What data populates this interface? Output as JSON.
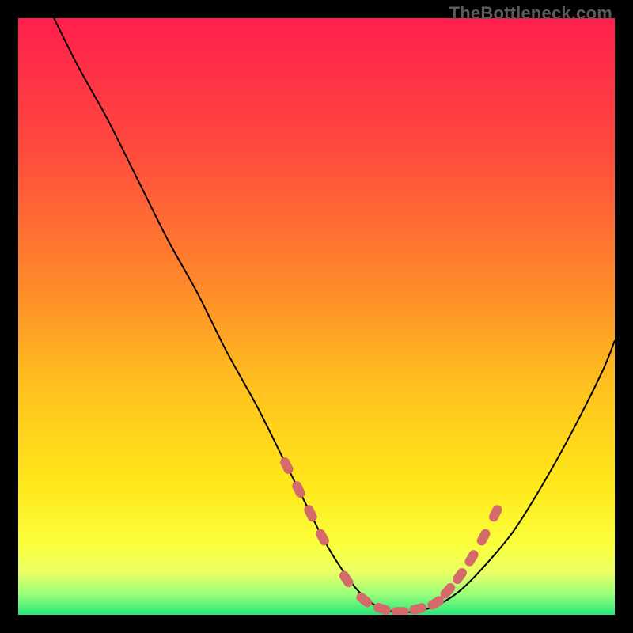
{
  "watermark": "TheBottleneck.com",
  "colors": {
    "frame": "#000000",
    "line": "#000000",
    "markers": "#d46a6a",
    "green_band_top": "#5bff8b",
    "green_band_bottom": "#28e67a"
  },
  "chart_data": {
    "type": "line",
    "title": "",
    "xlabel": "",
    "ylabel": "",
    "xlim": [
      0,
      100
    ],
    "ylim": [
      0,
      100
    ],
    "grid": false,
    "legend": false,
    "gradient_stops": [
      {
        "offset": 0.0,
        "color": "#ff1f4b"
      },
      {
        "offset": 0.22,
        "color": "#ff4a3e"
      },
      {
        "offset": 0.45,
        "color": "#ff8a2a"
      },
      {
        "offset": 0.62,
        "color": "#ffc21e"
      },
      {
        "offset": 0.78,
        "color": "#ffe71a"
      },
      {
        "offset": 0.88,
        "color": "#fbff3a"
      },
      {
        "offset": 0.93,
        "color": "#e9ff66"
      },
      {
        "offset": 0.965,
        "color": "#9bff7a"
      },
      {
        "offset": 1.0,
        "color": "#28e67a"
      }
    ],
    "series": [
      {
        "name": "bottleneck-curve",
        "x": [
          6,
          10,
          15,
          20,
          25,
          30,
          35,
          40,
          44,
          48,
          51,
          54,
          57,
          60,
          63,
          66,
          70,
          74,
          78,
          83,
          88,
          93,
          98,
          100
        ],
        "y": [
          100,
          92,
          83,
          73,
          63,
          54,
          44,
          35,
          27,
          19,
          13,
          8,
          4,
          1.5,
          0.5,
          0.5,
          1.5,
          4,
          8,
          14,
          22,
          31,
          41,
          46
        ]
      }
    ],
    "markers": {
      "name": "highlighted-points",
      "x": [
        45,
        47,
        49,
        51,
        55,
        58,
        61,
        64,
        67,
        70,
        72,
        74,
        76,
        78,
        80
      ],
      "y": [
        25,
        21,
        17,
        13,
        6,
        2.5,
        1,
        0.5,
        1,
        2,
        4,
        6.5,
        9.5,
        13,
        17
      ]
    }
  }
}
